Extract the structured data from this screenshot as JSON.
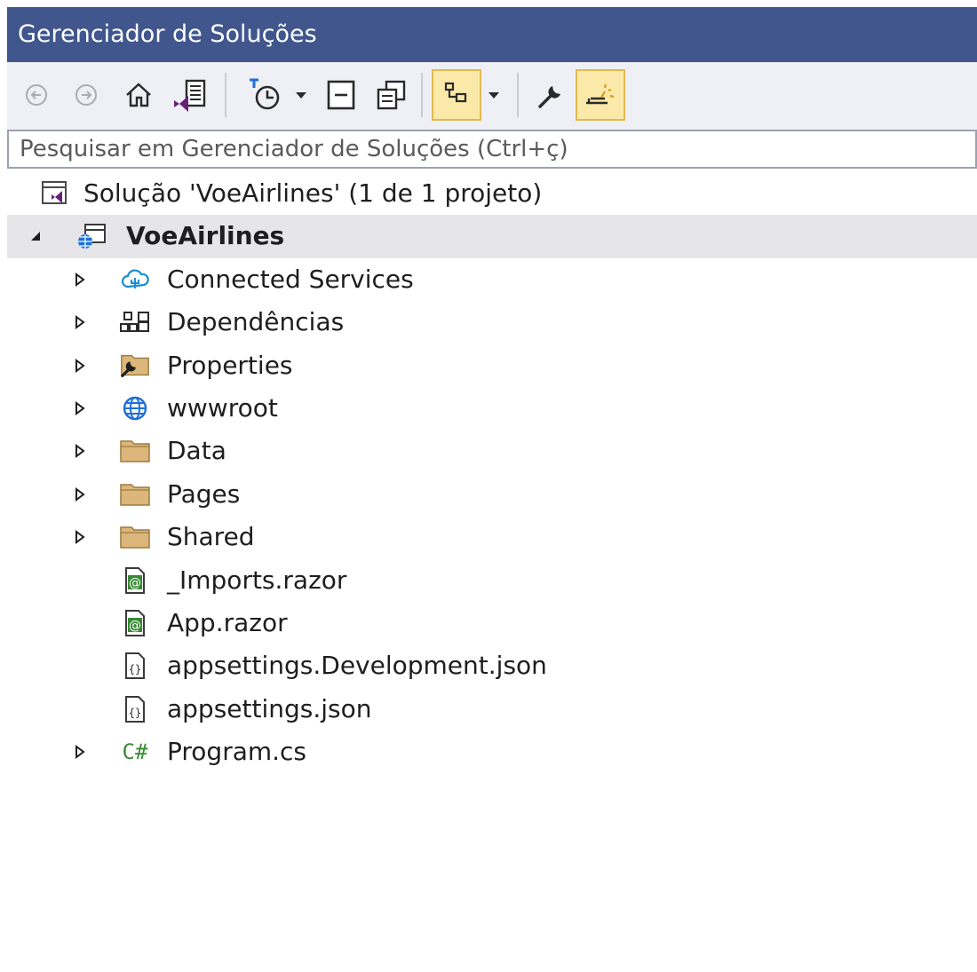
{
  "window": {
    "title": "Gerenciador de Soluções"
  },
  "toolbar": {
    "buttons": [
      {
        "name": "back-icon"
      },
      {
        "name": "forward-icon"
      },
      {
        "name": "home-icon"
      },
      {
        "name": "switch-views-icon"
      },
      {
        "name": "pending-changes-filter-icon"
      },
      {
        "name": "dropdown-arrow-icon"
      },
      {
        "name": "collapse-all-icon"
      },
      {
        "name": "show-all-files-icon"
      },
      {
        "name": "sync-with-active-document-icon"
      },
      {
        "name": "dropdown-arrow-icon"
      },
      {
        "name": "properties-wrench-icon"
      },
      {
        "name": "preview-selected-items-icon"
      }
    ]
  },
  "search": {
    "placeholder": "Pesquisar em Gerenciador de Soluções (Ctrl+ç)",
    "value": ""
  },
  "tree": {
    "solution": {
      "label": "Solução 'VoeAirlines' (1 de 1 projeto)",
      "icon": "solution-icon"
    },
    "project": {
      "label": "VoeAirlines",
      "icon": "web-project-icon",
      "expanded": true,
      "selected": true
    },
    "items": [
      {
        "label": "Connected Services",
        "icon": "connected-services-icon",
        "expandable": true
      },
      {
        "label": "Dependências",
        "icon": "dependencies-icon",
        "expandable": true
      },
      {
        "label": "Properties",
        "icon": "properties-folder-icon",
        "expandable": true
      },
      {
        "label": "wwwroot",
        "icon": "globe-icon",
        "expandable": true
      },
      {
        "label": "Data",
        "icon": "folder-icon",
        "expandable": true
      },
      {
        "label": "Pages",
        "icon": "folder-icon",
        "expandable": true
      },
      {
        "label": "Shared",
        "icon": "folder-icon",
        "expandable": true
      },
      {
        "label": "_Imports.razor",
        "icon": "razor-file-icon",
        "expandable": false
      },
      {
        "label": "App.razor",
        "icon": "razor-file-icon",
        "expandable": false
      },
      {
        "label": "appsettings.Development.json",
        "icon": "json-file-icon",
        "expandable": false
      },
      {
        "label": "appsettings.json",
        "icon": "json-file-icon",
        "expandable": false
      },
      {
        "label": "Program.cs",
        "icon": "csharp-file-icon",
        "icon_text": "C#",
        "expandable": true
      }
    ]
  },
  "colors": {
    "titlebar": "#40568d",
    "toolbar": "#eef0f5",
    "active_button": "#fbe9a9",
    "selected_row": "#e6e6e8",
    "folder": "#dcb67a",
    "csharp": "#388a34",
    "vs_purple": "#68217a"
  }
}
